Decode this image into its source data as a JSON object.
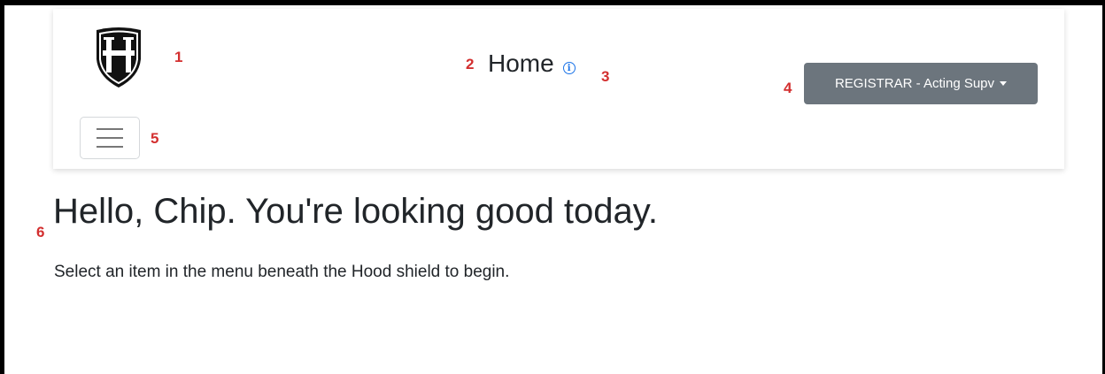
{
  "navbar": {
    "logo_icon": "hood-shield-logo",
    "menu_toggle_icon": "hamburger-icon",
    "page_title": "Home",
    "info_icon": "info-circle-icon",
    "role_dropdown_label": "REGISTRAR - Acting Supv"
  },
  "main": {
    "greeting": "Hello, Chip. You're looking good today.",
    "instructions": "Select an item in the menu beneath the Hood shield to begin."
  },
  "annotations": [
    "1",
    "2",
    "3",
    "4",
    "5",
    "6"
  ],
  "colors": {
    "annotation": "#d32f2f",
    "dropdown_bg": "#6c757d",
    "info_icon": "#1a73e8",
    "text": "#212529"
  }
}
